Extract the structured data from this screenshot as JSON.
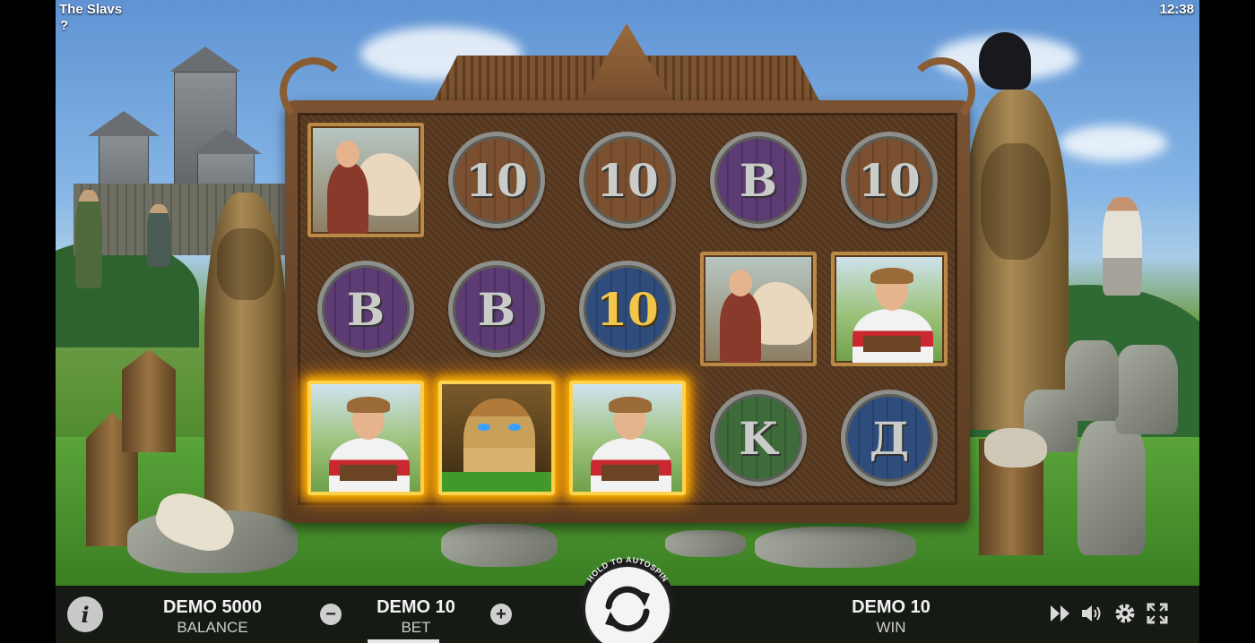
{
  "app": {
    "title": "The Slavs",
    "help": "?",
    "clock": "12:38"
  },
  "reels": {
    "columns": [
      [
        {
          "type": "portrait",
          "symbol": "knight-on-horse"
        },
        {
          "type": "coin",
          "letter": "B",
          "color": "purple"
        },
        {
          "type": "portrait",
          "symbol": "gusli-player",
          "win": true
        }
      ],
      [
        {
          "type": "coin",
          "letter": "10",
          "color": "brown"
        },
        {
          "type": "coin",
          "letter": "B",
          "color": "purple"
        },
        {
          "type": "portrait",
          "symbol": "idol-wild",
          "win": true
        }
      ],
      [
        {
          "type": "coin",
          "letter": "10",
          "color": "brown"
        },
        {
          "type": "coin",
          "letter": "10",
          "color": "blue",
          "gold": true
        },
        {
          "type": "portrait",
          "symbol": "gusli-player",
          "win": true
        }
      ],
      [
        {
          "type": "coin",
          "letter": "B",
          "color": "purple"
        },
        {
          "type": "portrait",
          "symbol": "knight-on-horse"
        },
        {
          "type": "coin",
          "letter": "K",
          "color": "green"
        }
      ],
      [
        {
          "type": "coin",
          "letter": "10",
          "color": "brown"
        },
        {
          "type": "portrait",
          "symbol": "gusli-player"
        },
        {
          "type": "coin",
          "letter": "Д",
          "color": "blue"
        }
      ]
    ]
  },
  "controls": {
    "balance_value": "DEMO 5000",
    "balance_label": "BALANCE",
    "bet_value": "DEMO 10",
    "bet_label": "BET",
    "win_value": "DEMO 10",
    "win_label": "WIN",
    "minus": "−",
    "plus": "+",
    "info": "i",
    "autospin_hint": "HOLD TO AUTOSPIN",
    "icons": [
      "fast-forward-icon",
      "sound-icon",
      "settings-icon",
      "fullscreen-icon"
    ]
  },
  "colors": {
    "win_glow": "#ffb300",
    "bar_bg": "#121212",
    "frame_wood": "#7a5232"
  }
}
